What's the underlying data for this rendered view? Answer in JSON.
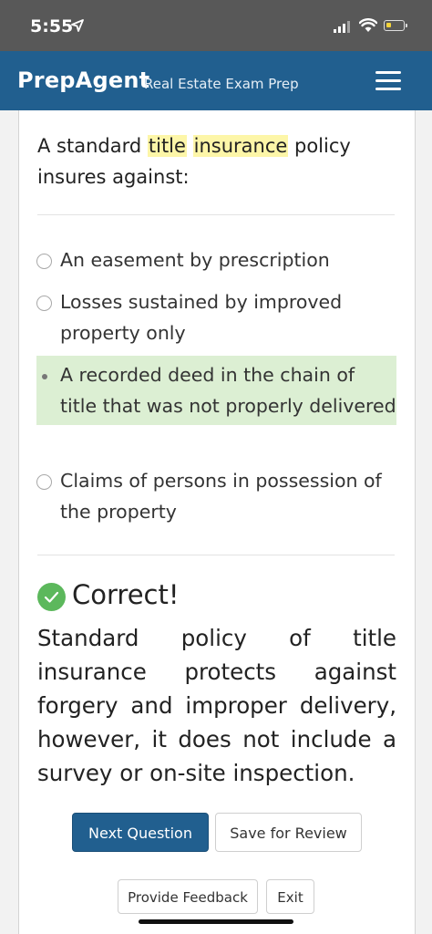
{
  "status_bar": {
    "time": "5:55",
    "icons": [
      "location-arrow-icon",
      "signal-icon",
      "wifi-icon",
      "battery-low-icon"
    ]
  },
  "app_bar": {
    "brand": "PrepAgent",
    "tagline": "Real Estate Exam Prep",
    "menu_icon": "hamburger-menu-icon",
    "background": "#215f8f"
  },
  "question": {
    "parts": [
      {
        "text": "A standard ",
        "highlight": false
      },
      {
        "text": "title",
        "highlight": true
      },
      {
        "text": " ",
        "highlight": false
      },
      {
        "text": "insurance",
        "highlight": true
      },
      {
        "text": " policy insures against:",
        "highlight": false
      }
    ]
  },
  "options": [
    {
      "label": "An easement by prescription",
      "selected": false
    },
    {
      "label": "Losses sustained by improved property only",
      "selected": false
    },
    {
      "label": "A recorded deed in the chain of title that was not properly delivered",
      "selected": true
    },
    {
      "label": "Claims of persons in possession of the property",
      "selected": false
    }
  ],
  "result": {
    "icon": "check-circle-icon",
    "title": "Correct!",
    "explanation": "Standard policy of title insurance protects against forgery and improper delivery, however, it does not include a survey or on-site inspection."
  },
  "buttons": {
    "next": "Next Question",
    "review": "Save for Review",
    "feedback": "Provide Feedback",
    "exit": "Exit"
  },
  "colors": {
    "accent": "#215f8f",
    "selected_option": "#dcefd3",
    "highlight": "#fdf6a8",
    "success": "#5cb85c"
  }
}
